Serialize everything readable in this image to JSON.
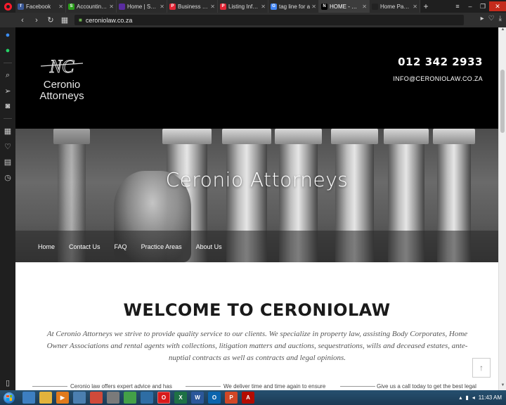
{
  "browser": {
    "tabs": [
      {
        "title": "Facebook",
        "favicon_color": "#3b5998",
        "favicon_letter": "f",
        "active": false
      },
      {
        "title": "Accounting - ",
        "favicon_color": "#2ca01c",
        "favicon_letter": "S",
        "active": false
      },
      {
        "title": "Home | Speed",
        "favicon_color": "#5a2ca0",
        "favicon_letter": "",
        "active": false
      },
      {
        "title": "Business Profi",
        "favicon_color": "#e32636",
        "favicon_letter": "P",
        "active": false
      },
      {
        "title": "Listing Info | S",
        "favicon_color": "#e32636",
        "favicon_letter": "P",
        "active": false
      },
      {
        "title": "tag line for a",
        "favicon_color": "#4285f4",
        "favicon_letter": "G",
        "active": false
      },
      {
        "title": "HOME - Cero",
        "favicon_color": "#000000",
        "favicon_letter": "N",
        "active": true
      },
      {
        "title": "Home Page - ",
        "favicon_color": "#222222",
        "favicon_letter": "",
        "active": false
      }
    ],
    "new_tab_label": "+",
    "url": "ceroniolaw.co.za"
  },
  "site": {
    "logo_initials": "NC",
    "logo_line1": "Ceronio",
    "logo_line2": "Attorneys",
    "phone": "012 342 2933",
    "email": "INFO@CERONIOLAW.CO.ZA",
    "hero_title": "Ceronio Attorneys",
    "nav": [
      {
        "label": "Home"
      },
      {
        "label": "Contact Us"
      },
      {
        "label": "FAQ"
      },
      {
        "label": "Practice Areas"
      },
      {
        "label": "About Us"
      }
    ],
    "welcome_heading": "WELCOME TO CERONIOLAW",
    "welcome_text": "At Ceronio Attorneys we strive to provide quality service to our clients. We specialize in property law, assisting Body Corporates, Home Owner Associations and rental agents with collections, litigation matters and auctions, sequestrations, wills and deceased estates, ante-nuptial contracts as well as contracts and legal opinions.",
    "cards": [
      {
        "text": "Ceronio law offers expert advice and has"
      },
      {
        "text": "We deliver time and time again to ensure"
      },
      {
        "text": "Give us a call today to get the best legal"
      }
    ],
    "back_to_top": "↑"
  },
  "taskbar": {
    "apps": [
      {
        "name": "explorer",
        "color": "#3d7fc1",
        "label": ""
      },
      {
        "name": "folder",
        "color": "#e2b33c",
        "label": ""
      },
      {
        "name": "media",
        "color": "#e07a1c",
        "label": "▶"
      },
      {
        "name": "app4",
        "color": "#4b7fb0",
        "label": ""
      },
      {
        "name": "chrome-like",
        "color": "#d04a3a",
        "label": ""
      },
      {
        "name": "app6",
        "color": "#7a7a7a",
        "label": ""
      },
      {
        "name": "app7",
        "color": "#43a047",
        "label": ""
      },
      {
        "name": "app8",
        "color": "#2e6da4",
        "label": ""
      },
      {
        "name": "opera",
        "color": "#d81b1b",
        "label": "O"
      },
      {
        "name": "excel",
        "color": "#1e7145",
        "label": "X"
      },
      {
        "name": "word",
        "color": "#2b579a",
        "label": "W"
      },
      {
        "name": "outlook",
        "color": "#0a64ad",
        "label": "O"
      },
      {
        "name": "powerpoint",
        "color": "#d24726",
        "label": "P"
      },
      {
        "name": "acrobat",
        "color": "#b30b00",
        "label": "A"
      }
    ],
    "clock": "11:43 AM"
  },
  "colors": {
    "header_bg": "#000000",
    "accent_red": "#ff1b2d",
    "taskbar_bg": "#1f4764"
  }
}
